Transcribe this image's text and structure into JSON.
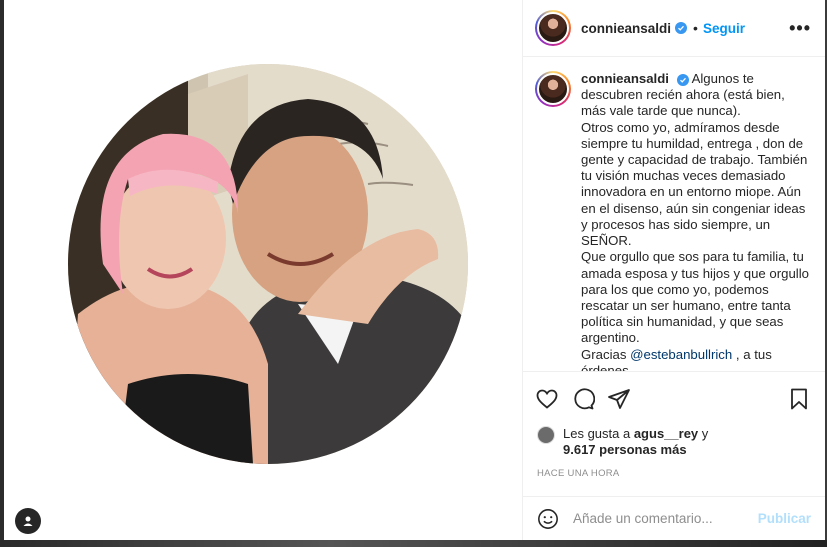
{
  "header": {
    "username": "connieansaldi",
    "follow_label": "Seguir",
    "separator": "•",
    "more_label": "•••"
  },
  "caption": {
    "username": "connieansaldi",
    "lines": [
      "Algunos te",
      "descubren recién ahora (está bien,",
      "más vale tarde que nunca).",
      "Otros como yo, admíramos desde",
      "siempre tu humildad, entrega , don de",
      "gente y capacidad de trabajo. También",
      "tu visión muchas veces demasiado",
      "innovadora en un entorno miope. Aún",
      "en el disenso, aún sin congeniar ideas",
      "y procesos has sido siempre, un",
      "SEÑOR.",
      "Que orgullo que sos para tu familia, tu",
      "amada esposa y tus hijos y que orgullo",
      "para los que como yo, podemos",
      "rescatar un ser humano, entre tanta",
      "política sin humanidad, y que seas",
      "argentino."
    ],
    "thanks_prefix": "Gracias ",
    "mention": "@estebanbullrich",
    "thanks_suffix": " , a tus",
    "last_line": "órdenes."
  },
  "likes": {
    "prefix": "Les gusta a ",
    "user": "agus__rey",
    "connector": " y",
    "count": "9.617 personas más"
  },
  "timestamp": "HACE UNA HORA",
  "add_comment": {
    "placeholder": "Añade un comentario...",
    "publish_label": "Publicar"
  },
  "icons": {
    "like": "heart-icon",
    "comment": "comment-icon",
    "share": "share-icon",
    "save": "bookmark-icon",
    "emoji": "emoji-icon",
    "verified": "verified-badge-icon",
    "tagged": "user-tag-icon"
  },
  "colors": {
    "accent": "#0095f6",
    "publish_disabled": "#b2dffc",
    "verified": "#3897f0"
  }
}
